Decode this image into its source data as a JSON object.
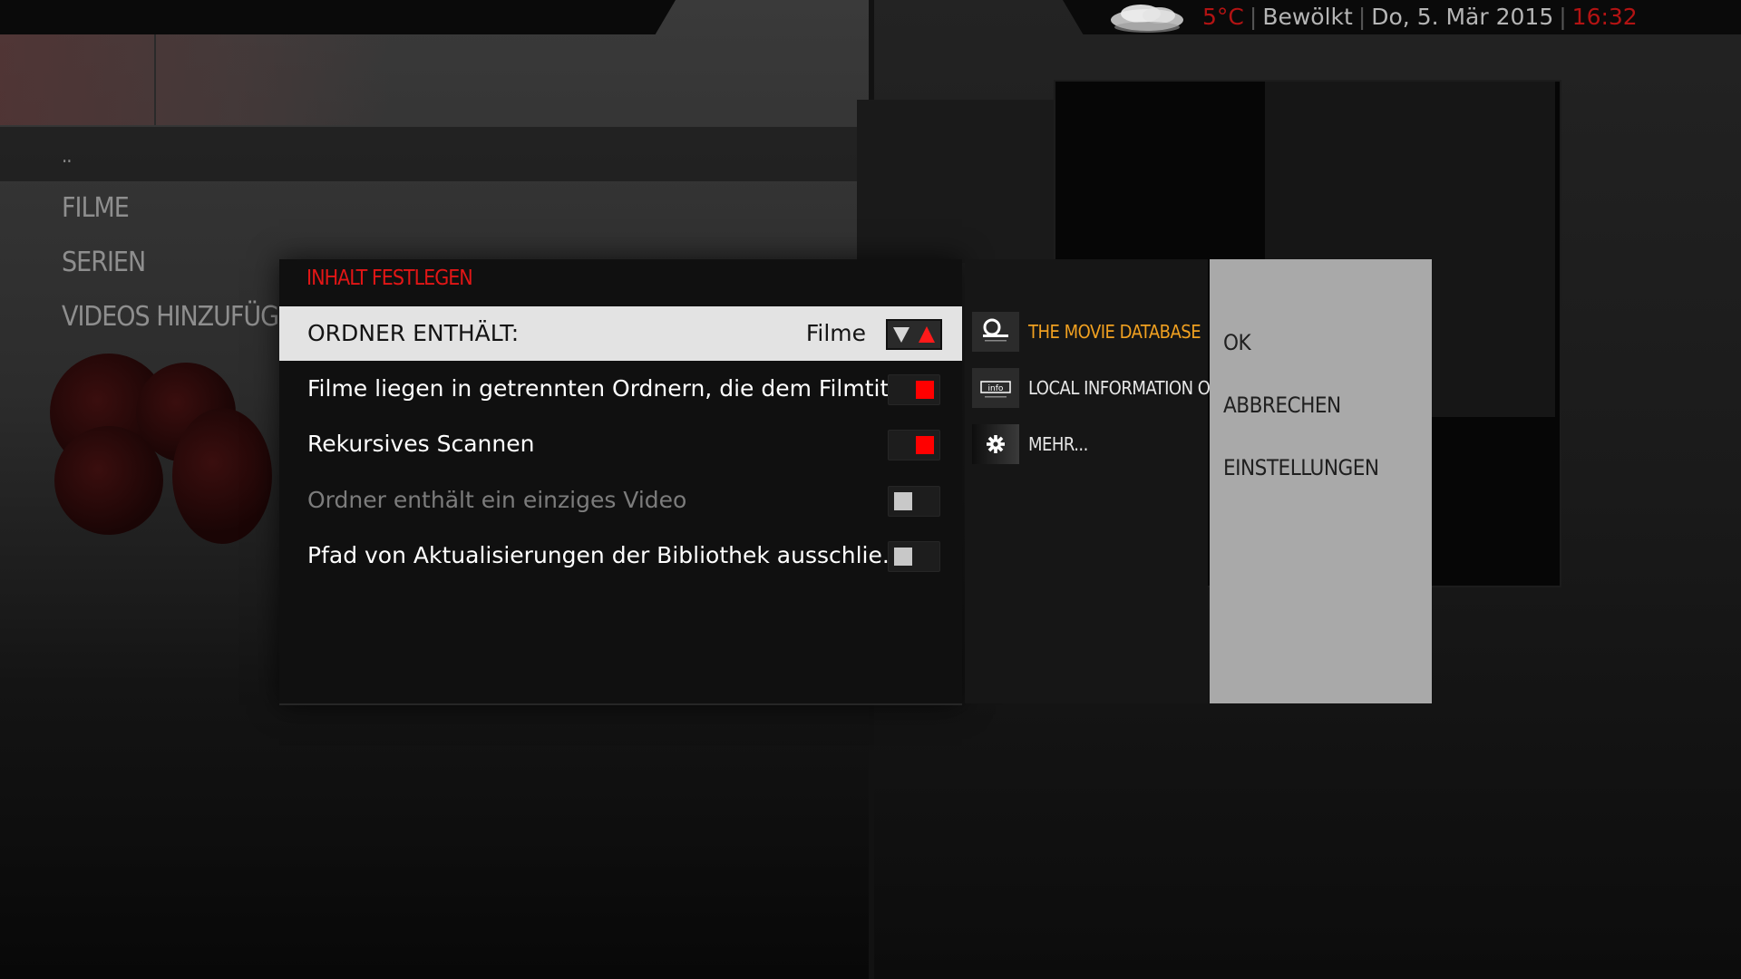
{
  "status_bar": {
    "temperature": "5°C",
    "weather": "Bewölkt",
    "date": "Do, 5. Mär 2015",
    "time": "16:32"
  },
  "nav": {
    "parent": "..",
    "items": [
      {
        "label": "FILME"
      },
      {
        "label": "SERIEN"
      },
      {
        "label": "VIDEOS HINZUFÜGEN..."
      }
    ]
  },
  "dialog": {
    "title": "INHALT FESTLEGEN",
    "settings": [
      {
        "label": "ORDNER ENTHÄLT:",
        "value": "Filme",
        "type": "spinner",
        "focused": true
      },
      {
        "label": "Filme liegen in getrennten Ordnern, die dem Filmtit...",
        "type": "toggle",
        "state": "on"
      },
      {
        "label": "Rekursives Scannen",
        "type": "toggle",
        "state": "on"
      },
      {
        "label": "Ordner enthält ein einziges Video",
        "type": "toggle",
        "state": "off",
        "disabled": true
      },
      {
        "label": "Pfad von Aktualisierungen der Bibliothek ausschlie...",
        "type": "toggle",
        "state": "off"
      }
    ],
    "providers": [
      {
        "label": "THE MOVIE DATABASE",
        "icon": "tmdb-logo-icon",
        "selected": true
      },
      {
        "label": "LOCAL INFORMATION O...",
        "icon": "info-logo-icon"
      },
      {
        "label": "MEHR...",
        "icon": "gear-icon"
      }
    ],
    "buttons": {
      "ok": "OK",
      "cancel": "ABBRECHEN",
      "settings": "EINSTELLUNGEN"
    }
  },
  "colors": {
    "accent_red": "#e21616",
    "toggle_on": "#ff0000",
    "selected_provider": "#f0a020",
    "focus_row": "#e3e3e3",
    "button_panel": "#a9a9a9"
  }
}
